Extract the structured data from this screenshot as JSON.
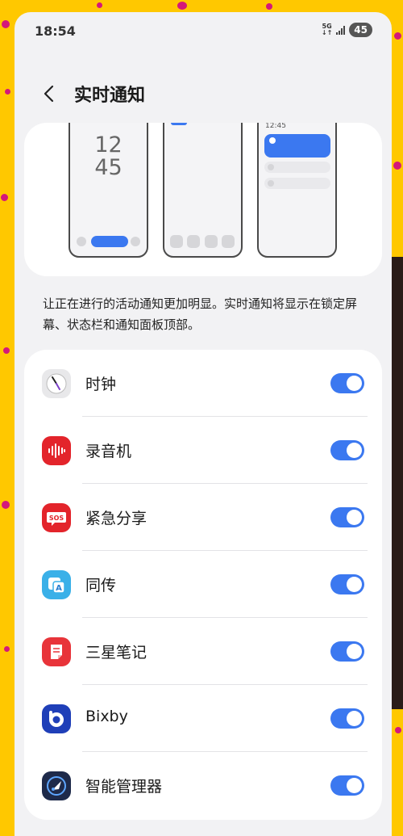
{
  "status_bar": {
    "time": "18:54",
    "network": "5G",
    "battery": "45"
  },
  "header": {
    "title": "实时通知",
    "back_icon": "chevron-left-icon"
  },
  "preview": {
    "lock_hours": "12",
    "lock_minutes": "45",
    "panel_time": "12:45"
  },
  "description": "让正在进行的活动通知更加明显。实时通知将显示在锁定屏幕、状态栏和通知面板顶部。",
  "apps": [
    {
      "label": "时钟",
      "icon": "clock-icon",
      "enabled": true
    },
    {
      "label": "录音机",
      "icon": "voice-recorder-icon",
      "enabled": true
    },
    {
      "label": "紧急分享",
      "icon": "sos-icon",
      "enabled": true
    },
    {
      "label": "同传",
      "icon": "translate-icon",
      "enabled": true
    },
    {
      "label": "三星笔记",
      "icon": "notes-icon",
      "enabled": true
    },
    {
      "label": "Bixby",
      "icon": "bixby-icon",
      "enabled": true
    },
    {
      "label": "智能管理器",
      "icon": "device-care-icon",
      "enabled": true
    }
  ],
  "colors": {
    "accent": "#3b78f0",
    "background_frame": "#ffc800",
    "screen_bg": "#f2f2f4"
  }
}
